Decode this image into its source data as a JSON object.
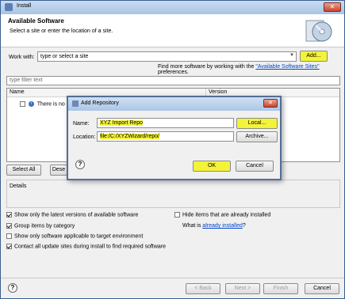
{
  "window": {
    "title": "Install"
  },
  "header": {
    "title": "Available Software",
    "subtitle": "Select a site or enter the location of a site."
  },
  "work_with": {
    "label": "Work with:",
    "value": "type or select a site",
    "add_label": "Add...",
    "find_more_prefix": "Find more software by working with the",
    "find_more_link": "\"Available Software Sites\"",
    "find_more_suffix": "preferences."
  },
  "filter": {
    "placeholder": "type filter text"
  },
  "table": {
    "columns": [
      "Name",
      "Version"
    ],
    "rows": [
      {
        "name": "There is no site"
      }
    ]
  },
  "buttons": {
    "select_all": "Select All",
    "deselect_all": "Dese"
  },
  "details": {
    "label": "Details"
  },
  "options": {
    "latest_versions": "Show only the latest versions of available software",
    "group_by_category": "Group items by category",
    "target_env": "Show only software applicable to target environment",
    "contact_sites": "Contact all update sites during install to find required software",
    "hide_installed": "Hide items that are already installed",
    "what_is_prefix": "What is",
    "already_installed": "already installed",
    "what_is_suffix": "?"
  },
  "footer": {
    "back": "< Back",
    "next": "Next >",
    "finish": "Finish",
    "cancel": "Cancel"
  },
  "dialog": {
    "title": "Add Repository",
    "name_label": "Name:",
    "name_value": "XYZ Import Repo",
    "local_label": "Local...",
    "location_label": "Location:",
    "location_value": "file:/C:/XYZWizard/repo/",
    "archive_label": "Archive...",
    "ok_label": "OK",
    "cancel_label": "Cancel"
  },
  "colors": {
    "highlight": "#f3f339",
    "link": "#0044cc",
    "titlebar": "#aac6e6"
  }
}
